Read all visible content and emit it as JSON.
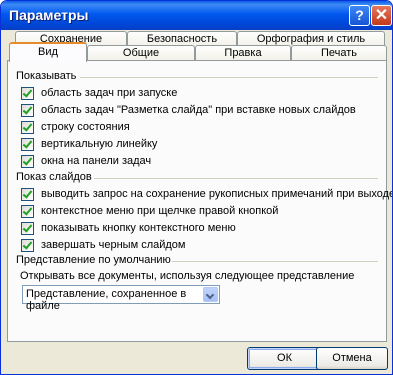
{
  "window": {
    "title": "Параметры",
    "help_glyph": "?",
    "close_glyph": "✕"
  },
  "tabs": {
    "row_back": [
      "Сохранение",
      "Безопасность",
      "Орфография и стиль"
    ],
    "row_front": [
      "Вид",
      "Общие",
      "Правка",
      "Печать"
    ],
    "active": "Вид"
  },
  "show_group": {
    "title": "Показывать",
    "items": [
      {
        "label": "область задач при запуске",
        "checked": true
      },
      {
        "label": "область задач \"Разметка слайда\" при вставке новых слайдов",
        "checked": true
      },
      {
        "label": "строку состояния",
        "checked": true
      },
      {
        "label": "вертикальную линейку",
        "checked": true
      },
      {
        "label": "окна на панели задач",
        "checked": true
      }
    ]
  },
  "slideshow_group": {
    "title": "Показ слайдов",
    "items": [
      {
        "label": "выводить запрос на сохранение рукописных примечаний при выходе",
        "checked": true
      },
      {
        "label": "контекстное меню при щелчке правой кнопкой",
        "checked": true
      },
      {
        "label": "показывать кнопку контекстного меню",
        "checked": true
      },
      {
        "label": "завершать черным слайдом",
        "checked": true
      }
    ]
  },
  "default_view_group": {
    "title": "Представление по умолчанию",
    "caption": "Открывать все документы, используя следующее представление",
    "selected": "Представление, сохраненное в файле"
  },
  "buttons": {
    "ok": "ОК",
    "cancel": "Отмена"
  }
}
